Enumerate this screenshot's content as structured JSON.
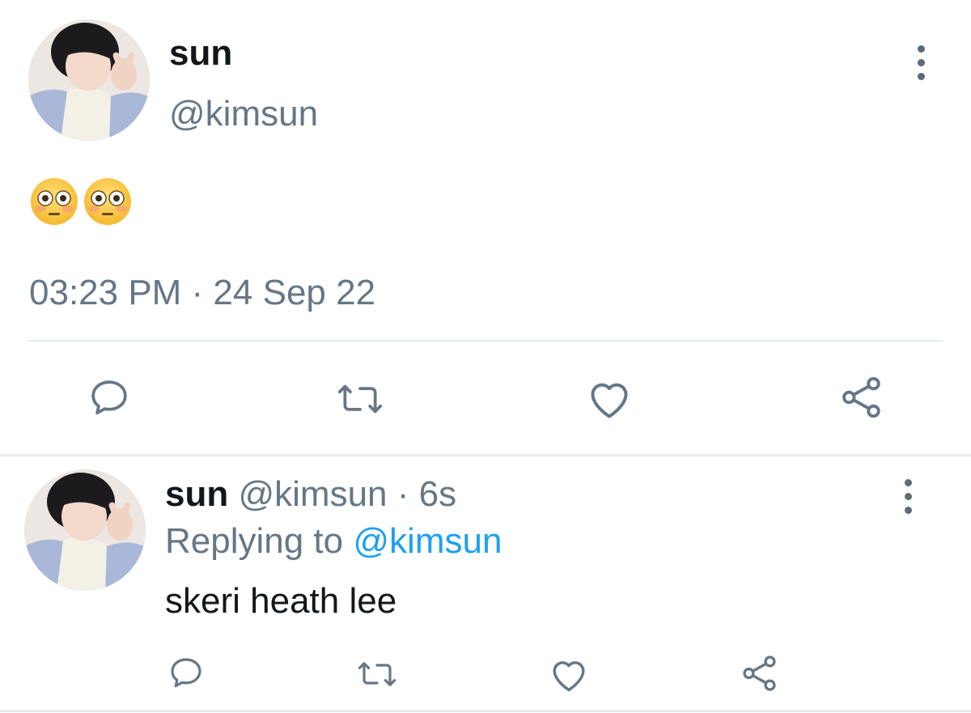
{
  "main_tweet": {
    "author_name": "sun",
    "author_handle": "@kimsun",
    "content_emoji": [
      "flushed-face",
      "flushed-face"
    ],
    "timestamp": "03:23 PM · 24 Sep 22",
    "actions": {
      "reply_icon": "speech-bubble-icon",
      "retweet_icon": "retweet-icon",
      "like_icon": "heart-icon",
      "share_icon": "share-icon"
    }
  },
  "reply_tweet": {
    "author_name": "sun",
    "author_handle": "@kimsun",
    "separator": "·",
    "time_ago": "6s",
    "replying_prefix": "Replying to",
    "replying_to": "@kimsun",
    "text": "skeri heath lee"
  },
  "colors": {
    "text_primary": "#14171a",
    "text_secondary": "#657786",
    "link": "#1da1f2",
    "icon": "#657786",
    "divider": "#e6ecf0"
  }
}
